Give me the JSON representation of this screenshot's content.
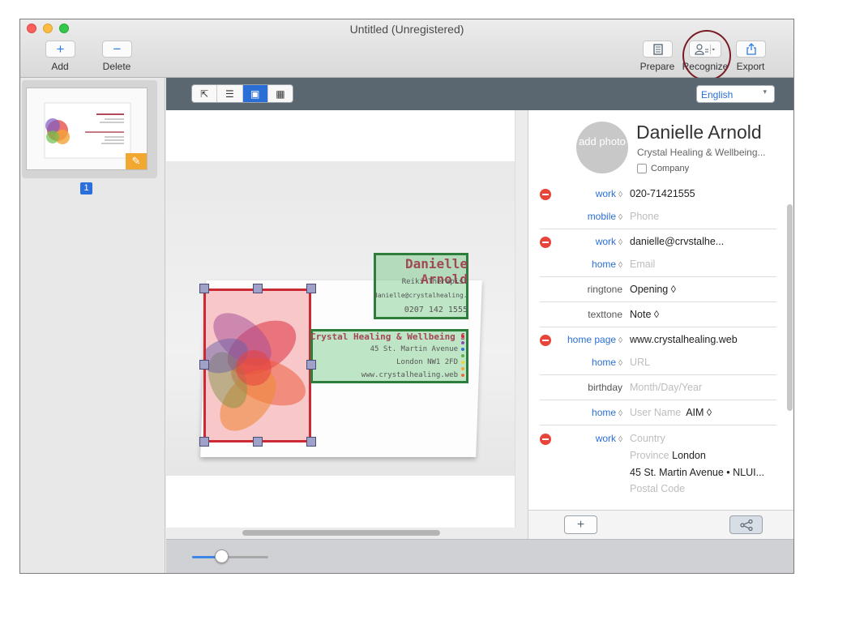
{
  "window": {
    "title": "Untitled (Unregistered)"
  },
  "toolbar": {
    "add_label": "Add",
    "delete_label": "Delete",
    "prepare_label": "Prepare",
    "recognize_label": "Recognize",
    "export_label": "Export"
  },
  "sidebar": {
    "page_number": "1"
  },
  "view_modes": [
    "select",
    "text",
    "image",
    "table"
  ],
  "language": {
    "selected": "English"
  },
  "card": {
    "name": "Danielle Arnold",
    "title": "Reiki Therapist",
    "email": "danielle@crystalhealing.web",
    "phone": "0207 142 1555",
    "company": "Crystal Healing & Wellbeing Studio",
    "address1": "45 St. Martin Avenue",
    "address2": "London NW1 2FD",
    "website": "www.crystalhealing.web"
  },
  "contact": {
    "avatar_text": "add photo",
    "name": "Danielle Arnold",
    "org": "Crystal Healing & Wellbeing...",
    "company_checkbox": "Company",
    "rows": [
      {
        "label": "work",
        "value": "020-71421555",
        "placeholder": false,
        "removable": true,
        "chevron": true
      },
      {
        "label": "mobile",
        "value": "Phone",
        "placeholder": true,
        "removable": false,
        "chevron": true
      },
      {
        "label": "work",
        "value": "danielle@crvstalhe...",
        "placeholder": false,
        "removable": true,
        "chevron": true
      },
      {
        "label": "home",
        "value": "Email",
        "placeholder": true,
        "removable": false,
        "chevron": true
      },
      {
        "label": "ringtone",
        "value": "Opening ◊",
        "placeholder": false,
        "removable": false,
        "chevron": false
      },
      {
        "label": "texttone",
        "value": "Note ◊",
        "placeholder": false,
        "removable": false,
        "chevron": false
      },
      {
        "label": "home page",
        "value": "www.crystalhealing.web",
        "placeholder": false,
        "removable": true,
        "chevron": true
      },
      {
        "label": "home",
        "value": "URL",
        "placeholder": true,
        "removable": false,
        "chevron": true
      },
      {
        "label": "birthday",
        "value": "Month/Day/Year",
        "placeholder": true,
        "removable": false,
        "chevron": false
      },
      {
        "label": "home",
        "value": "User Name",
        "placeholder": true,
        "removable": false,
        "chevron": true,
        "extra": "AIM ◊"
      }
    ],
    "address": {
      "label": "work",
      "country": "Country",
      "province_label": "Province",
      "province": "London",
      "street": "45 St. Martin Avenue • NLUI...",
      "postal": "Postal Code"
    }
  },
  "colors": {
    "accent": "#2b6fd6",
    "red_box": "#c92a33",
    "green_box": "#2e7d3a",
    "edit_badge": "#f2a830"
  },
  "zoom_slider": {
    "value": 0.38
  }
}
